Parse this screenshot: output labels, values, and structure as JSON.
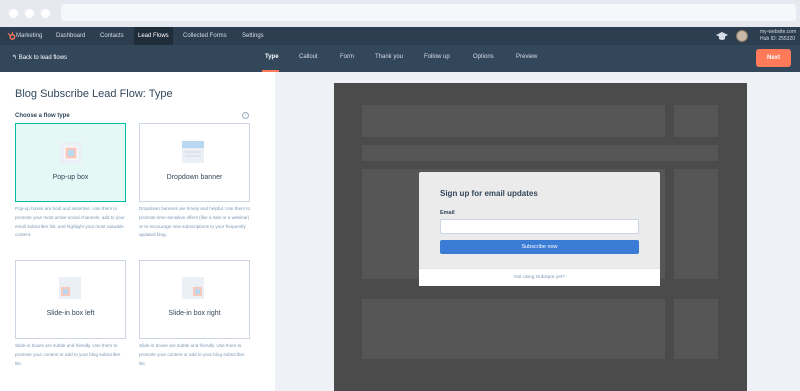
{
  "nav": {
    "brand": "Marketing",
    "items": [
      "Dashboard",
      "Contacts",
      "Lead Flows",
      "Collected Forms",
      "Settings"
    ],
    "account_site": "my-website.com",
    "account_hub": "Hub ID: 255320"
  },
  "subbar": {
    "back_label": "Back to lead flows",
    "tabs": [
      "Type",
      "Callout",
      "Form",
      "Thank you",
      "Follow up",
      "Options",
      "Preview"
    ],
    "next_label": "Next"
  },
  "panel": {
    "title": "Blog Subscribe Lead Flow: Type",
    "subtitle": "Choose a flow type",
    "help": "?",
    "options": [
      {
        "label": "Pop-up box",
        "selected": true,
        "desc": "Pop-up boxes are bold and assertive. Use them to promote your most active social channels, add to your email subscriber list, and highlight your most valuable content."
      },
      {
        "label": "Dropdown banner",
        "selected": false,
        "desc": "Dropdown banners are timely and helpful. Use them to promote time-sensitive offers (like a sale or a webinar) or to encourage new subscriptions to your frequently updated blog."
      },
      {
        "label": "Slide-in box left",
        "selected": false,
        "desc": "Slide-in boxes are subtle and friendly. Use them to promote your content or add to your blog subscriber list."
      },
      {
        "label": "Slide-in box right",
        "selected": false,
        "desc": "Slide-in boxes are subtle and friendly. Use them to promote your content or add to your blog subscriber list."
      }
    ]
  },
  "preview": {
    "heading": "Sign up for email updates",
    "field_label": "Email",
    "button": "Subscribe now",
    "footer": "Not using HubSpot yet?"
  },
  "colors": {
    "nav_bg": "#2d3e50",
    "subbar_bg": "#33475b",
    "accent_orange": "#ff7a59",
    "selected_teal": "#00bda5",
    "subscribe_blue": "#3a7bd5"
  }
}
